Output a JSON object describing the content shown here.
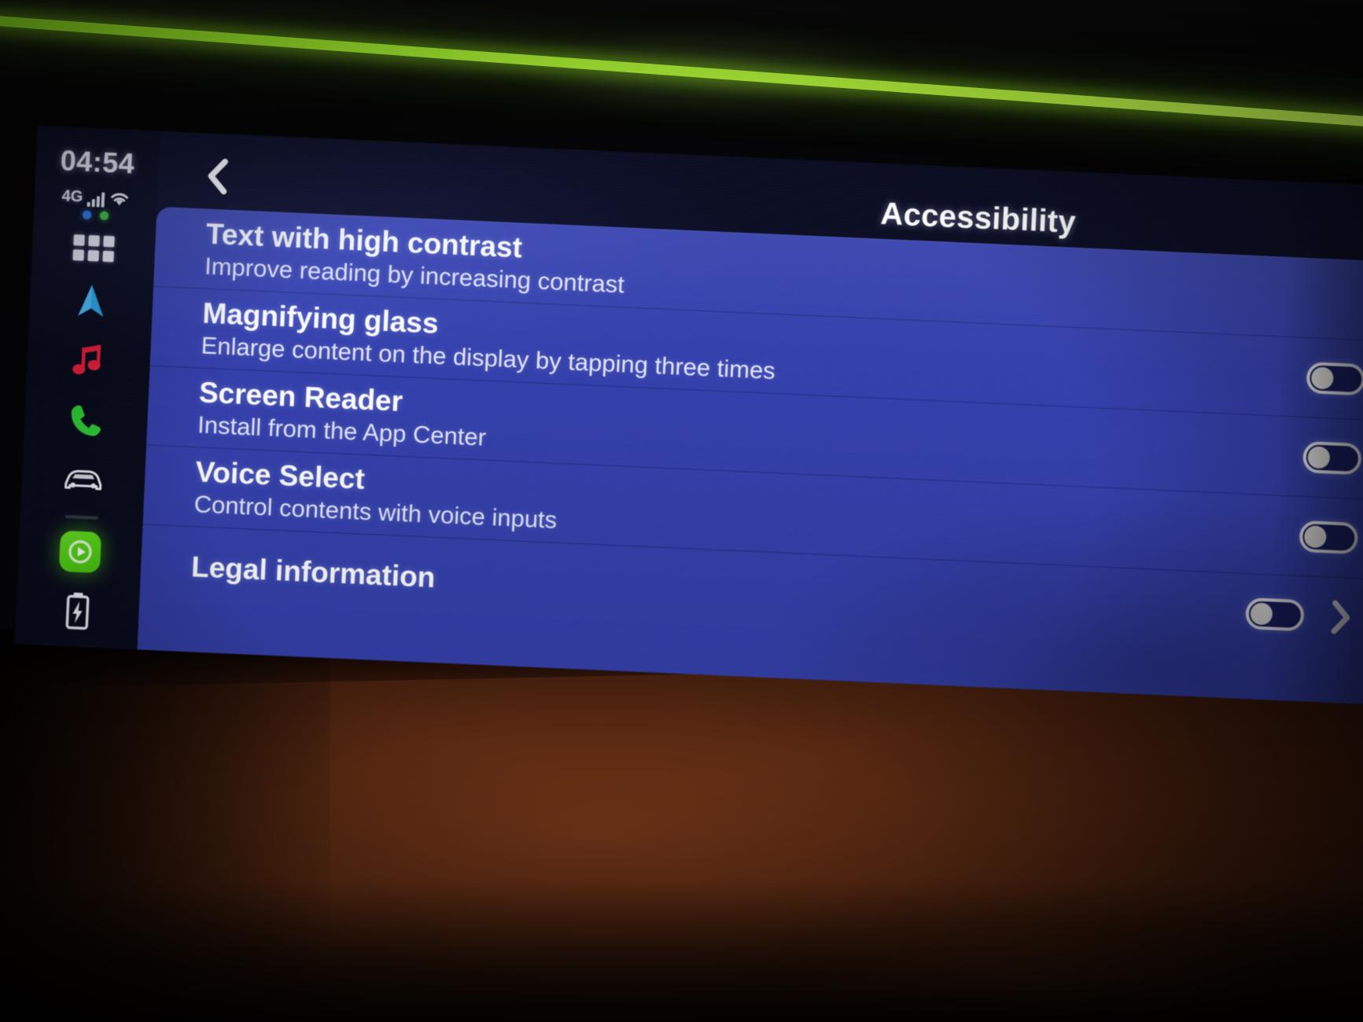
{
  "status_bar": {
    "time": "04:54",
    "network_label": "4G",
    "signal_icon": "signal-bars-icon",
    "wifi_icon": "wifi-icon",
    "indicator_dots": [
      {
        "name": "bluetooth-indicator-dot",
        "color": "#2f7ce8"
      },
      {
        "name": "location-indicator-dot",
        "color": "#3fc642"
      }
    ]
  },
  "sidebar": {
    "apps_grid_icon": "apps-grid-icon",
    "items": [
      {
        "name": "navigation-icon",
        "label": "Navigation",
        "color": "#2aa8ef"
      },
      {
        "name": "music-icon",
        "label": "Media",
        "color": "#e81f3d"
      },
      {
        "name": "phone-icon",
        "label": "Phone",
        "color": "#2fd03a"
      },
      {
        "name": "car-icon",
        "label": "Vehicle",
        "color": "#ffffff"
      }
    ],
    "app_tile": {
      "name": "media-player-app-icon",
      "label": "Player",
      "color": "#52d514"
    },
    "battery": {
      "name": "battery-charging-icon",
      "label": "Charging"
    }
  },
  "header": {
    "back_icon": "chevron-left-icon",
    "title": "Accessibility"
  },
  "list": {
    "rows": [
      {
        "title": "Text with high contrast",
        "subtitle": "Improve reading by increasing contrast",
        "control": "none",
        "toggle_state": ""
      },
      {
        "title": "Magnifying glass",
        "subtitle": "Enlarge content on the display by tapping three times",
        "control": "toggle",
        "toggle_state": "off"
      },
      {
        "title": "Screen Reader",
        "subtitle": "Install from the App Center",
        "control": "toggle",
        "toggle_state": "off"
      },
      {
        "title": "Voice Select",
        "subtitle": "Control contents with voice inputs",
        "control": "toggle",
        "toggle_state": "off"
      },
      {
        "title": "Legal information",
        "subtitle": "",
        "control": "toggle-and-chevron",
        "toggle_state": "off"
      }
    ]
  },
  "theme": {
    "panel_background": "#3440ac",
    "screen_background": "#0b0d24",
    "text_primary": "#ffffff",
    "text_secondary": "#e4e7fa",
    "ambient_strip": "#a8f032",
    "dashboard": "#5a2a12"
  }
}
